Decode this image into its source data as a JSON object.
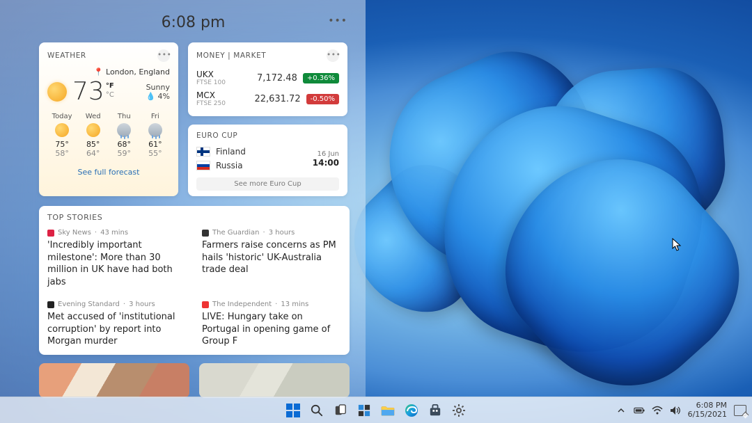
{
  "panel": {
    "time": "6:08 pm"
  },
  "weather": {
    "title": "WEATHER",
    "location": "London, England",
    "temp": "73",
    "unit_f": "°F",
    "unit_c": "°C",
    "condition": "Sunny",
    "humidity": "4%",
    "forecast": [
      {
        "day": "Today",
        "icon": "sun",
        "hi": "75°",
        "lo": "58°"
      },
      {
        "day": "Wed",
        "icon": "sun",
        "hi": "85°",
        "lo": "64°"
      },
      {
        "day": "Thu",
        "icon": "rain",
        "hi": "68°",
        "lo": "59°"
      },
      {
        "day": "Fri",
        "icon": "rain",
        "hi": "61°",
        "lo": "55°"
      }
    ],
    "link": "See full forecast"
  },
  "money": {
    "title": "MONEY | MARKET",
    "rows": [
      {
        "code": "UKX",
        "name": "FTSE 100",
        "value": "7,172.48",
        "change": "+0.36%",
        "dir": "up"
      },
      {
        "code": "MCX",
        "name": "FTSE 250",
        "value": "22,631.72",
        "change": "-0.50%",
        "dir": "down"
      }
    ]
  },
  "euro": {
    "title": "EURO CUP",
    "team1": "Finland",
    "team2": "Russia",
    "date": "16 Jun",
    "time": "14:00",
    "link": "See more Euro Cup"
  },
  "stories": {
    "title": "TOP STORIES",
    "items": [
      {
        "source": "Sky News",
        "age": "43 mins",
        "color": "#d24",
        "headline": "'Incredibly important milestone': More than 30 million in UK have had both jabs"
      },
      {
        "source": "The Guardian",
        "age": "3 hours",
        "color": "#333",
        "headline": "Farmers raise concerns as PM hails 'historic' UK-Australia trade deal"
      },
      {
        "source": "Evening Standard",
        "age": "3 hours",
        "color": "#222",
        "headline": "Met accused of 'institutional corruption' by report into Morgan murder"
      },
      {
        "source": "The Independent",
        "age": "13 mins",
        "color": "#e33",
        "headline": "LIVE: Hungary take on Portugal in opening game of Group F"
      }
    ]
  },
  "taskbar": {
    "time": "6:08 PM",
    "date": "6/15/2021"
  }
}
